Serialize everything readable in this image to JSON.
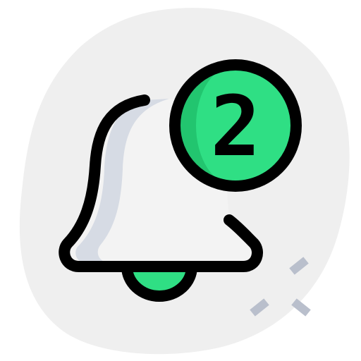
{
  "icon": {
    "name": "notification-bell-icon",
    "badge_count": "2"
  },
  "colors": {
    "background_blob": "#efefef",
    "bell_fill": "#f3f3f3",
    "bell_shadow": "#d6dbe4",
    "accent_green": "#2fdf84",
    "accent_green_dark": "#22c56f",
    "outline": "#000000",
    "sparkle": "#b9bfcc"
  }
}
